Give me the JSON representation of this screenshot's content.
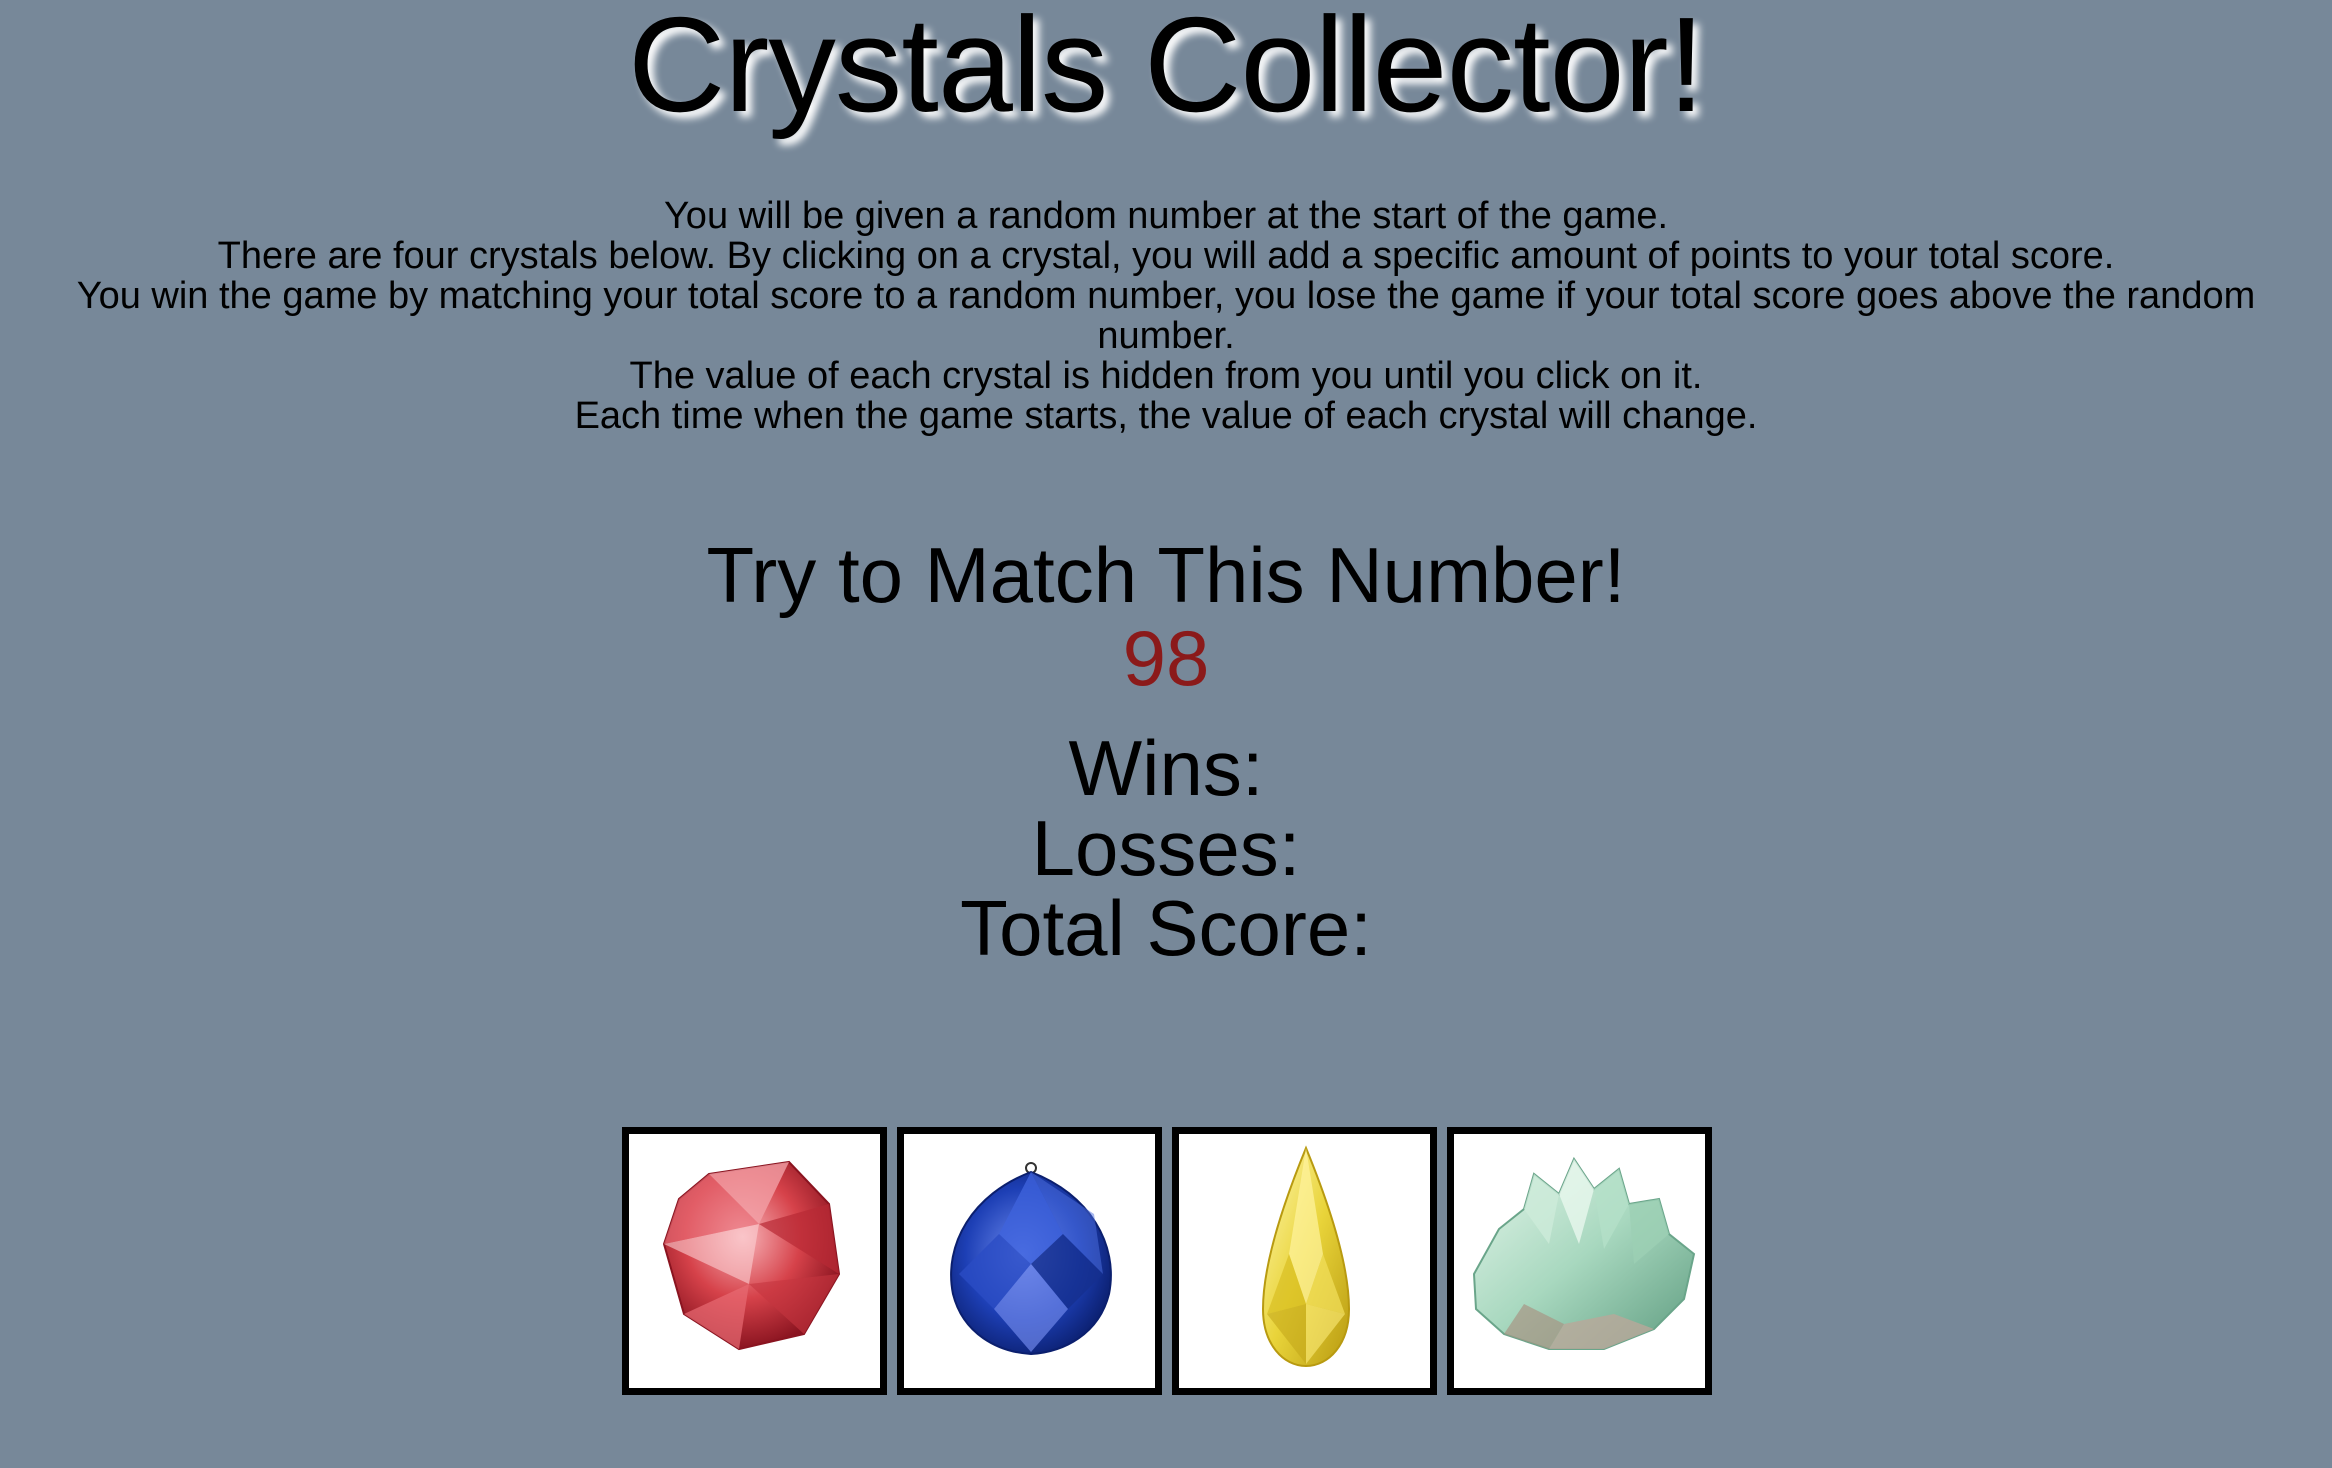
{
  "title": "Crystals Collector!",
  "instructions": [
    "You will be given a random number at the start of the game.",
    "There are four crystals below. By clicking on a crystal, you will add a specific amount of points to your total score.",
    "You win the game by matching your total score to a random number, you lose the game if your total score goes above the random number.",
    "The value of each crystal is hidden from you until you click on it.",
    "Each time when the game starts, the value of each crystal will change."
  ],
  "match": {
    "label": "Try to Match This Number!",
    "number": "98",
    "number_color": "#8b1a1a"
  },
  "stats": {
    "wins_label": "Wins:",
    "losses_label": "Losses:",
    "total_label": "Total Score:"
  },
  "crystals": [
    {
      "icon": "red-crystal-icon",
      "color": "#d6424a"
    },
    {
      "icon": "blue-crystal-icon",
      "color": "#1d3fb5"
    },
    {
      "icon": "yellow-crystal-icon",
      "color": "#e9d43a"
    },
    {
      "icon": "green-crystal-icon",
      "color": "#a8d8bf"
    }
  ],
  "colors": {
    "background": "#778899"
  }
}
